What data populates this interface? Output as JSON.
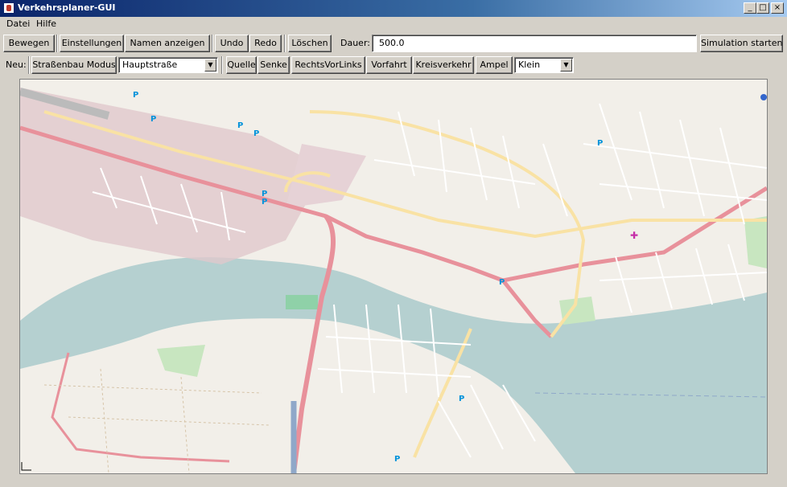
{
  "window": {
    "title": "Verkehrsplaner-GUI"
  },
  "menu": [
    "Datei",
    "Hilfe"
  ],
  "toolbar": {
    "bewegen": "Bewegen",
    "einstellungen": "Einstellungen",
    "namen": "Namen anzeigen",
    "undo": "Undo",
    "redo": "Redo",
    "loeschen": "Löschen",
    "dauer_label": "Dauer:",
    "dauer_value": "500.0",
    "simulation": "Simulation starten"
  },
  "toolbar2": {
    "neu_label": "Neu:",
    "strassenbau": "Straßenbau Modus",
    "strassentyp": "Hauptstraße",
    "quelle": "Quelle",
    "senke": "Senke",
    "rechtsvorlinks": "RechtsVorLinks",
    "vorfahrt": "Vorfahrt",
    "kreisverkehr": "Kreisverkehr",
    "ampel": "Ampel",
    "groesse": "Klein"
  },
  "colors": {
    "titlebar_start": "#0a246a",
    "titlebar_end": "#a6caf0",
    "window_bg": "#d4d0c8",
    "map_land": "#f2efe9",
    "map_water": "#b5d0d0",
    "map_industrial": "#e0c8cc",
    "map_main_road": "#e8919b",
    "map_secondary_road": "#f9e2a4",
    "map_park": "#c8e6c0"
  }
}
